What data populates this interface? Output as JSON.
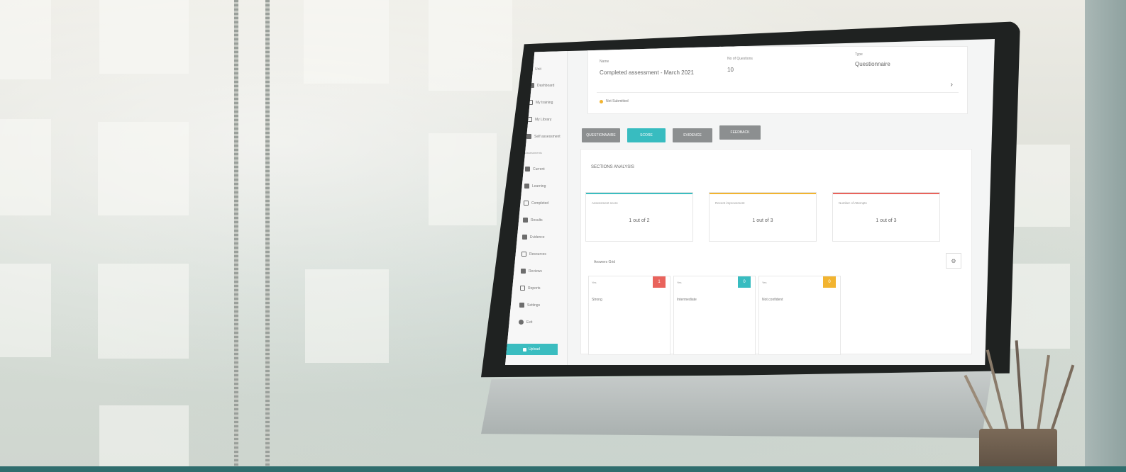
{
  "sidebar": {
    "title": "Unit",
    "items": [
      {
        "label": "Dashboard",
        "icon": "grid-icon"
      },
      {
        "label": "My training",
        "icon": "book-icon"
      },
      {
        "label": "My Library",
        "icon": "library-icon"
      },
      {
        "label": "Self assessment",
        "icon": "checklist-icon"
      }
    ],
    "section_label": "Assessments",
    "section_items": [
      {
        "label": "Current",
        "icon": "file-icon"
      },
      {
        "label": "Learning",
        "icon": "book-icon"
      },
      {
        "label": "Completed",
        "icon": "check-icon"
      },
      {
        "label": "Results",
        "icon": "chart-icon"
      },
      {
        "label": "Evidence",
        "icon": "folder-icon"
      },
      {
        "label": "Resources",
        "icon": "link-icon"
      },
      {
        "label": "Reviews",
        "icon": "star-icon"
      },
      {
        "label": "Reports",
        "icon": "report-icon"
      },
      {
        "label": "Settings",
        "icon": "gear-icon"
      },
      {
        "label": "Exit",
        "icon": "exit-icon"
      }
    ],
    "upload_label": "Upload"
  },
  "info": {
    "name_label": "Name",
    "name_value": "Completed assessment - March 2021",
    "questions_label": "No of Questions",
    "questions_value": "10",
    "type_label": "Type",
    "type_value": "Questionnaire",
    "status": "Not Submitted"
  },
  "buttons": [
    {
      "label": "QUESTIONNAIRE",
      "style": "grey"
    },
    {
      "label": "SCORE",
      "style": "teal"
    },
    {
      "label": "EVIDENCE",
      "style": "grey"
    },
    {
      "label": "FEEDBACK",
      "style": "grey"
    }
  ],
  "sections": {
    "title": "SECTIONS ANALYSIS",
    "boxes": [
      {
        "label": "Assessment score",
        "value": "1 out of 2",
        "color": "#3bbdc0"
      },
      {
        "label": "Recent improvement",
        "value": "1 out of 3",
        "color": "#f2b430"
      },
      {
        "label": "Number of Attempts",
        "value": "1 out of 3",
        "color": "#e9635c"
      }
    ]
  },
  "answers": {
    "title": "Answers Grid",
    "columns": [
      {
        "head": "Yes",
        "badge": "1",
        "badge_color": "#e9635c",
        "name": "Strong"
      },
      {
        "head": "Yes",
        "badge": "0",
        "badge_color": "#38bcc0",
        "name": "Intermediate"
      },
      {
        "head": "Yes",
        "badge": "0",
        "badge_color": "#f2b430",
        "name": "Not confident"
      }
    ]
  }
}
